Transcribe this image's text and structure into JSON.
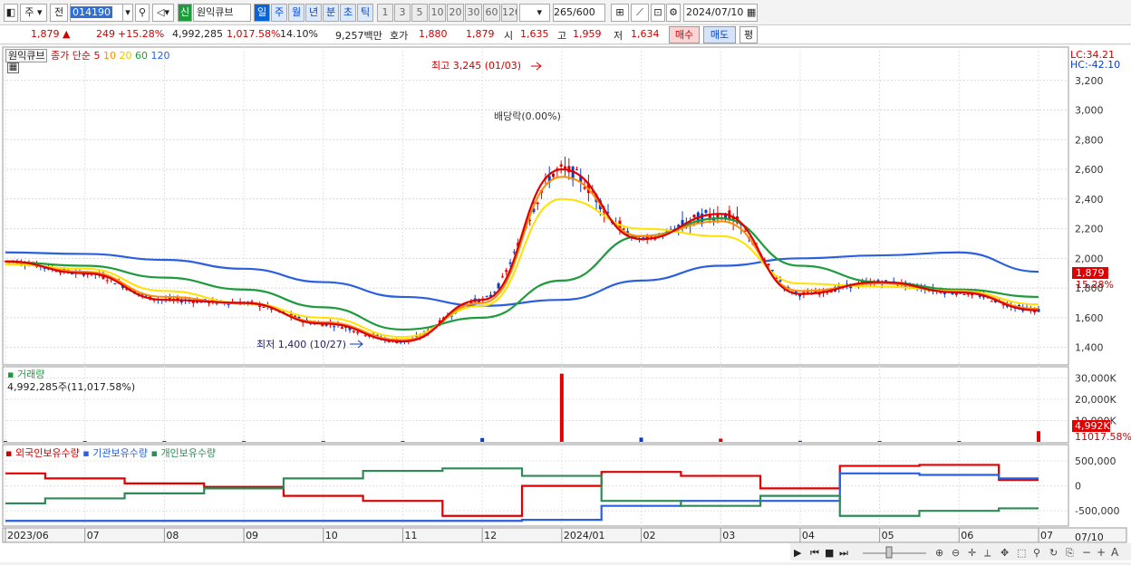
{
  "toolbar": {
    "period_select": "주",
    "prev_label": "전",
    "code": "014190",
    "badge": "신",
    "name": "원익큐브",
    "periods": [
      "일",
      "주",
      "월",
      "년",
      "분",
      "초",
      "틱"
    ],
    "intervals": [
      "1",
      "3",
      "5",
      "10",
      "20",
      "30",
      "60",
      "120"
    ],
    "count": "265",
    "count_total": "/600",
    "date": "2024/07/10"
  },
  "quote": {
    "price": "1,879",
    "change": "249",
    "change_pct": "+15.28%",
    "volume": "4,992,285",
    "volume_ratio": "1,017.58%",
    "turnover_rate": "14.10%",
    "amount": "9,257백만",
    "bid_ask_label": "호가",
    "ask": "1,880",
    "bid": "1,879",
    "open_label": "시",
    "open": "1,635",
    "high_label": "고",
    "high": "1,959",
    "low_label": "저",
    "low": "1,634",
    "buy_label": "매수",
    "sell_label": "매도",
    "avg_label": "평"
  },
  "legend": {
    "name": "원익큐브",
    "close_simple": "종가 단순",
    "ma": [
      "5",
      "10",
      "20",
      "60",
      "120"
    ]
  },
  "annotations": {
    "high": "최고 3,245 (01/03)",
    "low": "최저 1,400 (10/27)",
    "dividend": "배당락(0.00%)",
    "lc": "LC:34.21",
    "hc": "HC:-42.10",
    "current_price": "1,879",
    "current_pct": "15.28%",
    "volume_current": "4,992K",
    "volume_ratio": "11017.58%"
  },
  "volume_panel": {
    "title": "거래량",
    "value": "4,992,285주(11,017.58%)"
  },
  "holdings_panel": {
    "series": [
      "외국인보유수량",
      "기관보유수량",
      "개인보유수량"
    ]
  },
  "x_axis": {
    "labels": [
      "2023/06",
      "07",
      "08",
      "09",
      "10",
      "11",
      "12",
      "2024/01",
      "02",
      "03",
      "04",
      "05",
      "06",
      "07"
    ],
    "end_label": "07/10"
  },
  "colors": {
    "candle_up": "#e00000",
    "candle_down": "#0a3cc8",
    "ma5": "#e00000",
    "ma10": "#ff8c00",
    "ma20": "#ffe000",
    "ma60": "#1e9b3c",
    "ma120": "#2a5fe0",
    "foreign": "#e00000",
    "institution": "#2a5fe0",
    "individual": "#2e8b57"
  },
  "chart_data": [
    {
      "type": "line",
      "title": "원익큐브 종가 단순 5 10 20 60 120",
      "x": [
        "2023/06",
        "07",
        "08",
        "09",
        "10",
        "11",
        "12",
        "2024/01",
        "02",
        "03",
        "04",
        "05",
        "06",
        "07"
      ],
      "y_ticks": [
        1400,
        1600,
        1800,
        2000,
        2200,
        2400,
        2600,
        2800,
        3000,
        3200
      ],
      "ylim": [
        1300,
        3400
      ],
      "series": [
        {
          "name": "5",
          "values": [
            1980,
            1900,
            1720,
            1700,
            1560,
            1440,
            1720,
            2600,
            2130,
            2300,
            1760,
            1840,
            1770,
            1650
          ]
        },
        {
          "name": "10",
          "values": [
            1975,
            1910,
            1740,
            1695,
            1570,
            1450,
            1700,
            2550,
            2150,
            2250,
            1780,
            1830,
            1775,
            1660
          ]
        },
        {
          "name": "20",
          "values": [
            1960,
            1930,
            1780,
            1700,
            1600,
            1470,
            1680,
            2400,
            2200,
            2150,
            1830,
            1810,
            1780,
            1690
          ]
        },
        {
          "name": "60",
          "values": [
            1975,
            1950,
            1870,
            1790,
            1670,
            1520,
            1600,
            1850,
            2150,
            2270,
            1950,
            1840,
            1790,
            1740
          ]
        },
        {
          "name": "120",
          "values": [
            2040,
            2030,
            1990,
            1930,
            1840,
            1740,
            1680,
            1720,
            1850,
            1950,
            2000,
            2020,
            2040,
            1910
          ]
        }
      ],
      "annotations": [
        "최고 3,245 (01/03)",
        "최저 1,400 (10/27)",
        "배당락(0.00%)"
      ]
    },
    {
      "type": "bar",
      "title": "거래량",
      "y_ticks": [
        "10,000K",
        "20,000K",
        "30,000K"
      ],
      "categories": [
        "2023/06",
        "07",
        "08",
        "09",
        "10",
        "11",
        "12",
        "2024/01",
        "02",
        "03",
        "04",
        "05",
        "06",
        "07"
      ],
      "values": [
        200,
        200,
        300,
        200,
        200,
        300,
        1800,
        32000,
        2000,
        1500,
        500,
        300,
        300,
        4992
      ]
    },
    {
      "type": "line",
      "title": "보유수량",
      "y_ticks": [
        "500,000",
        "0",
        "-500,000"
      ],
      "ylim": [
        -750000,
        700000
      ],
      "x": [
        "2023/06",
        "07",
        "08",
        "09",
        "10",
        "11",
        "12",
        "2024/01",
        "02",
        "03",
        "04",
        "05",
        "06",
        "07"
      ],
      "series": [
        {
          "name": "외국인보유수량",
          "values": [
            250000,
            150000,
            50000,
            -20000,
            -200000,
            -300000,
            -600000,
            0,
            280000,
            200000,
            -50000,
            400000,
            420000,
            120000
          ]
        },
        {
          "name": "기관보유수량",
          "values": [
            -700000,
            -700000,
            -700000,
            -700000,
            -700000,
            -700000,
            -700000,
            -680000,
            -400000,
            -300000,
            -300000,
            250000,
            220000,
            150000
          ]
        },
        {
          "name": "개인보유수량",
          "values": [
            -350000,
            -250000,
            -150000,
            -50000,
            150000,
            300000,
            350000,
            200000,
            -300000,
            -400000,
            -200000,
            -600000,
            -500000,
            -450000
          ]
        }
      ]
    }
  ]
}
